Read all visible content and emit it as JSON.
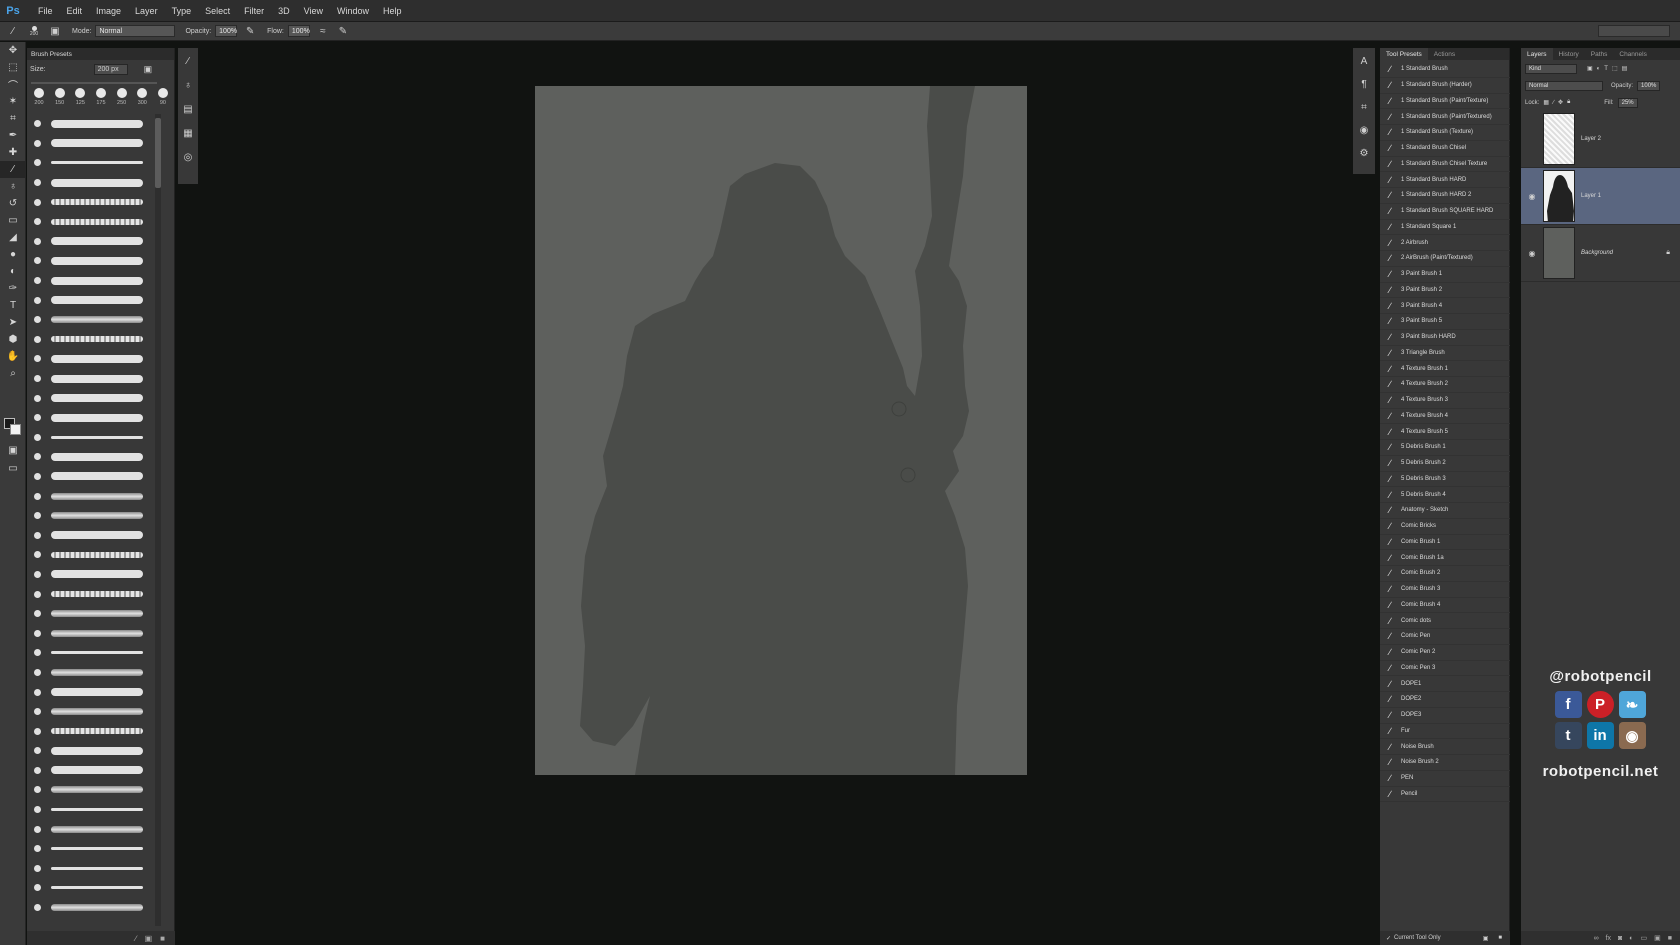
{
  "app": {
    "logo": "Ps"
  },
  "menu": [
    "File",
    "Edit",
    "Image",
    "Layer",
    "Type",
    "Select",
    "Filter",
    "3D",
    "View",
    "Window",
    "Help"
  ],
  "options": {
    "brush_size": "200",
    "mode_label": "Mode:",
    "mode_value": "Normal",
    "opacity_label": "Opacity:",
    "opacity_value": "100%",
    "flow_label": "Flow:",
    "flow_value": "100%"
  },
  "brush_presets": {
    "title": "Brush Presets",
    "size_label": "Size:",
    "size_value": "200 px",
    "tips": [
      "200",
      "150",
      "125",
      "175",
      "250",
      "300",
      "90"
    ],
    "footer_icons": [
      "brush-settings-icon",
      "new-preset-icon",
      "delete-icon"
    ]
  },
  "tool_presets": {
    "tabs": [
      "Tool Presets",
      "Actions"
    ],
    "items": [
      "1 Standard Brush",
      "1 Standard Brush (Harder)",
      "1 Standard Brush (Paint/Texture)",
      "1 Standard Brush (Paint/Textured)",
      "1 Standard Brush (Texture)",
      "1 Standard Brush Chisel",
      "1 Standard Brush Chisel Texture",
      "1 Standard Brush HARD",
      "1 Standard Brush HARD 2",
      "1 Standard Brush SQUARE HARD",
      "1 Standard Square 1",
      "2 Airbrush",
      "2 AirBrush (Paint/Textured)",
      "3 Paint Brush 1",
      "3 Paint Brush 2",
      "3 Paint Brush 4",
      "3 Paint Brush 5",
      "3 Paint Brush HARD",
      "3 Triangle Brush",
      "4 Texture Brush 1",
      "4 Texture Brush 2",
      "4 Texture Brush 3",
      "4 Texture Brush 4",
      "4 Texture Brush 5",
      "5 Debris Brush 1",
      "5 Debris Brush 2",
      "5 Debris Brush 3",
      "5 Debris Brush 4",
      "Anatomy - Sketch",
      "Comic Bricks",
      "Comic Brush 1",
      "Comic Brush 1a",
      "Comic Brush 2",
      "Comic Brush 3",
      "Comic Brush 4",
      "Comic dots",
      "Comic Pen",
      "Comic Pen 2",
      "Comic Pen 3",
      "DOPE1",
      "DOPE2",
      "DOPE3",
      "Fur",
      "Noise Brush",
      "Noise Brush 2",
      "PEN",
      "Pencil"
    ],
    "footer": "Current Tool Only"
  },
  "layers": {
    "tabs": [
      "Layers",
      "History",
      "Paths",
      "Channels"
    ],
    "kind_label": "Kind",
    "blend_mode": "Normal",
    "opacity_label": "Opacity:",
    "opacity_value": "100%",
    "lock_label": "Lock:",
    "fill_label": "Fill:",
    "fill_value": "25%",
    "items": [
      {
        "name": "Layer 2",
        "visible": false,
        "selected": false
      },
      {
        "name": "Layer 1",
        "visible": true,
        "selected": true
      },
      {
        "name": "Background",
        "visible": true,
        "selected": false,
        "locked": true
      }
    ]
  },
  "social": {
    "handle": "@robotpencil",
    "icons": [
      "facebook-icon",
      "pinterest-icon",
      "twitter-icon",
      "tumblr-icon",
      "linkedin-icon",
      "instagram-icon"
    ],
    "site": "robotpencil.net"
  },
  "colors": {
    "canvas": "#5e605d",
    "silhouette": "#4a4c49",
    "selected_layer": "#5a6680",
    "background": "#111311"
  }
}
